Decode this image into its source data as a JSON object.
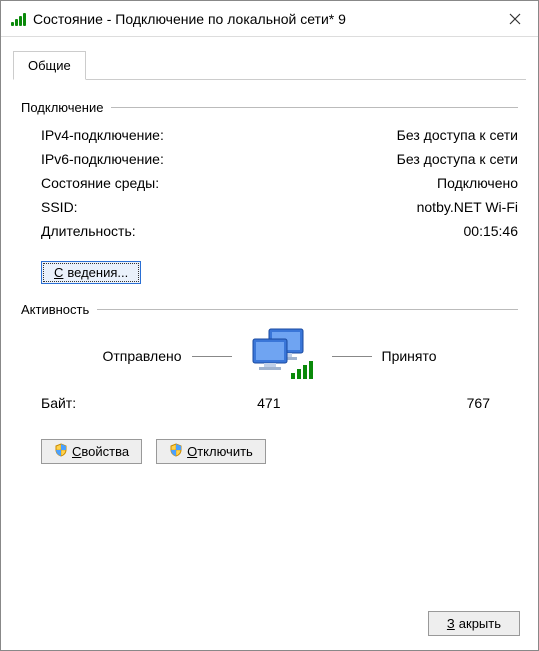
{
  "window": {
    "title": "Состояние - Подключение по локальной сети* 9"
  },
  "tabs": {
    "general": "Общие"
  },
  "groups": {
    "connection": "Подключение",
    "activity": "Активность"
  },
  "connection": {
    "ipv4_label": "IPv4-подключение:",
    "ipv4_value": "Без доступа к сети",
    "ipv6_label": "IPv6-подключение:",
    "ipv6_value": "Без доступа к сети",
    "media_label": "Состояние среды:",
    "media_value": "Подключено",
    "ssid_label": "SSID:",
    "ssid_value": "notby.NET Wi-Fi",
    "duration_label": "Длительность:",
    "duration_value": "00:15:46"
  },
  "buttons": {
    "details_prefix": "С",
    "details_rest": "ведения...",
    "properties_prefix": "С",
    "properties_rest": "войства",
    "disable_prefix": "О",
    "disable_rest": "тключить",
    "close_prefix": "З",
    "close_rest": "акрыть"
  },
  "activity": {
    "sent_label": "Отправлено",
    "received_label": "Принято",
    "bytes_label": "Байт:",
    "bytes_sent": "471",
    "bytes_received": "767"
  }
}
